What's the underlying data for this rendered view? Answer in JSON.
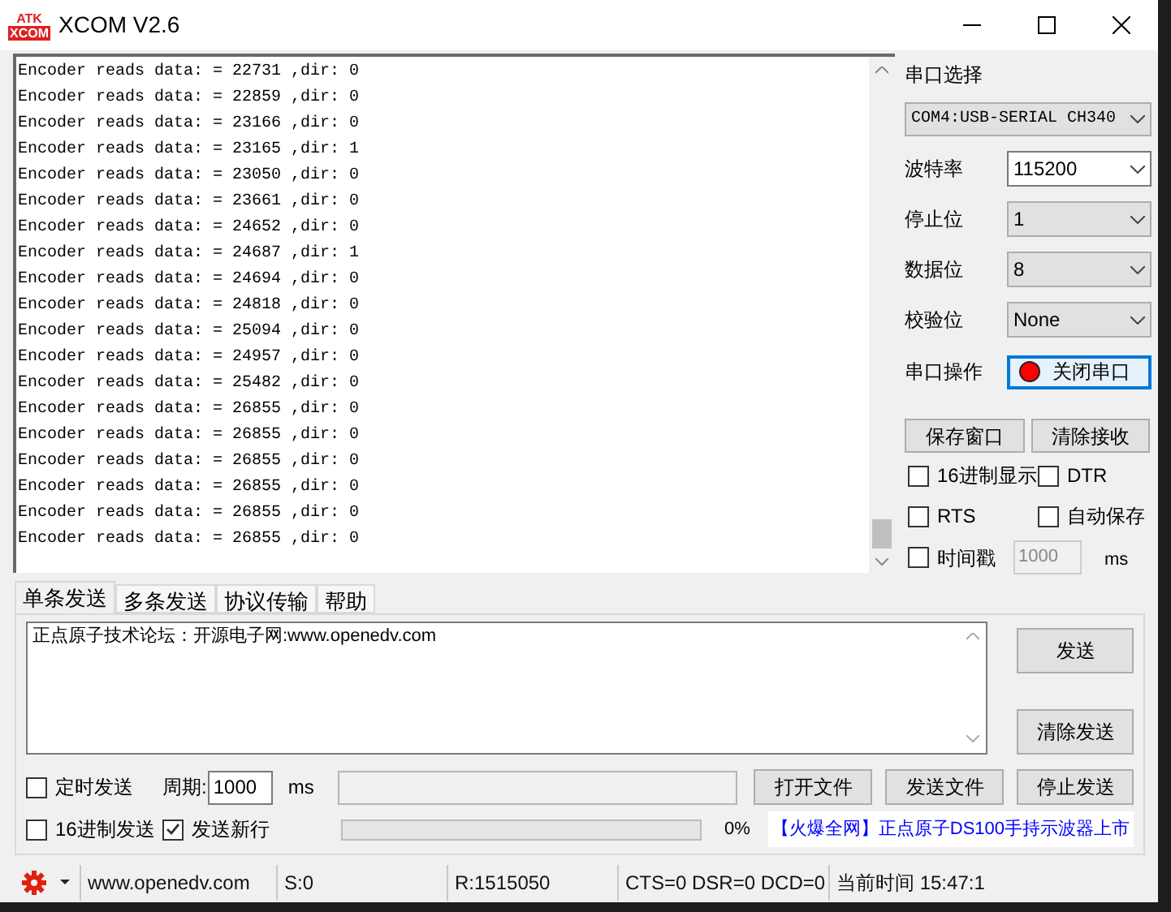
{
  "window": {
    "title": "XCOM V2.6",
    "logo": [
      "ATK",
      "XCOM"
    ]
  },
  "receive_lines": [
    "Encoder reads data: = 22731 ,dir: 0",
    "Encoder reads data: = 22859 ,dir: 0",
    "Encoder reads data: = 23166 ,dir: 0",
    "Encoder reads data: = 23165 ,dir: 1",
    "Encoder reads data: = 23050 ,dir: 0",
    "Encoder reads data: = 23661 ,dir: 0",
    "Encoder reads data: = 24652 ,dir: 0",
    "Encoder reads data: = 24687 ,dir: 1",
    "Encoder reads data: = 24694 ,dir: 0",
    "Encoder reads data: = 24818 ,dir: 0",
    "Encoder reads data: = 25094 ,dir: 0",
    "Encoder reads data: = 24957 ,dir: 0",
    "Encoder reads data: = 25482 ,dir: 0",
    "Encoder reads data: = 26855 ,dir: 0",
    "Encoder reads data: = 26855 ,dir: 0",
    "Encoder reads data: = 26855 ,dir: 0",
    "Encoder reads data: = 26855 ,dir: 0",
    "Encoder reads data: = 26855 ,dir: 0",
    "Encoder reads data: = 26855 ,dir: 0"
  ],
  "settings": {
    "port_label": "串口选择",
    "port": "COM4:USB-SERIAL CH340",
    "fields": [
      {
        "label": "波特率",
        "value": "115200",
        "editable": true
      },
      {
        "label": "停止位",
        "value": "1",
        "editable": false
      },
      {
        "label": "数据位",
        "value": "8",
        "editable": false
      },
      {
        "label": "校验位",
        "value": "None",
        "editable": false
      }
    ],
    "operation_label": "串口操作",
    "operation_button": "关闭串口",
    "port_open": true,
    "save_button": "保存窗口",
    "clear_button": "清除接收",
    "options": [
      {
        "label": "16进制显示",
        "checked": false
      },
      {
        "label": "DTR",
        "checked": false
      },
      {
        "label": "RTS",
        "checked": false
      },
      {
        "label": "自动保存",
        "checked": false
      }
    ],
    "timestamp": {
      "label": "时间戳",
      "checked": false,
      "value": "1000",
      "field_disabled": true,
      "unit": "ms"
    }
  },
  "send_tabs": [
    {
      "label": "单条发送",
      "selected": true
    },
    {
      "label": "多条发送",
      "selected": false
    },
    {
      "label": "协议传输",
      "selected": false
    },
    {
      "label": "帮助",
      "selected": false
    }
  ],
  "send_text": "正点原子技术论坛：开源电子网:www.openedv.com",
  "send_button": "发送",
  "clear_send_button": "清除发送",
  "timed_send": {
    "label": "定时发送",
    "checked": false
  },
  "period_label": "周期:",
  "period": "1000",
  "period_unit": "ms",
  "open_file_button": "打开文件",
  "send_file_button": "发送文件",
  "stop_send_button": "停止发送",
  "hex_send": {
    "label": "16进制发送",
    "checked": false
  },
  "send_newline": {
    "label": "发送新行",
    "checked": true
  },
  "progress": {
    "level": 0,
    "reading": "0%"
  },
  "ad_link": "【火爆全网】正点原子DS100手持示波器上市",
  "status_bar": [
    "www.openedv.com",
    "S:0",
    "R:1515050",
    "CTS=0 DSR=0 DCD=0",
    "当前时间 15:47:1"
  ]
}
